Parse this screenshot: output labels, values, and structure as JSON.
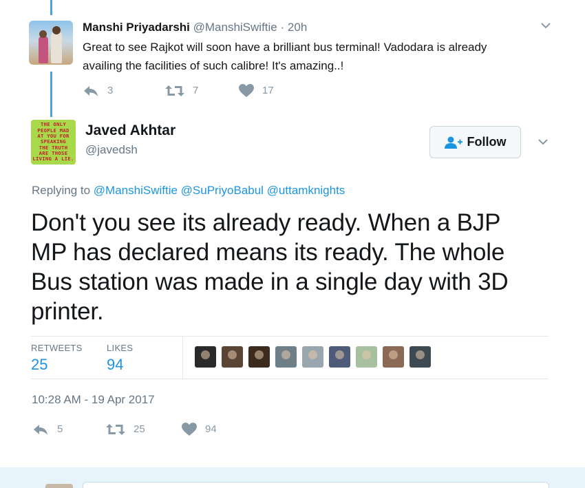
{
  "parent_tweet": {
    "name": "Manshi Priyadarshi",
    "handle": "@ManshiSwiftie",
    "dot": "·",
    "time": "20h",
    "text_line1": "Great to see Rajkot will soon have a brilliant bus terminal! Vadodara is already",
    "text_line2": "availing the facilities of such calibre! It's amazing..!",
    "replies": "3",
    "retweets": "7",
    "likes": "17"
  },
  "main_tweet": {
    "name": "Javed Akhtar",
    "handle": "@javedsh",
    "avatar_text": [
      "THE ONLY",
      "PEOPLE MAD",
      "AT YOU FOR",
      "SPEAKING",
      "THE TRUTH",
      "ARE THOSE",
      "LIVING A LIE."
    ],
    "follow_label": "Follow",
    "replying_prefix": "Replying to",
    "mentions": [
      "@ManshiSwiftie",
      "@SuPriyoBabul",
      "@uttamknights"
    ],
    "text_lines": [
      "Don't you see its already ready. When a BJP",
      "MP has declared means its ready. The whole",
      "Bus station was made in a single day with 3D",
      "printer."
    ],
    "retweets_label": "RETWEETS",
    "retweets_count": "25",
    "likes_label": "LIKES",
    "likes_count": "94",
    "timestamp": "10:28 AM - 19 Apr 2017",
    "action_replies": "5",
    "action_retweets": "25",
    "action_likes": "94"
  },
  "liker_avatars": [
    {
      "name": "liker-avatar-1",
      "color": "#2a2a2a"
    },
    {
      "name": "liker-avatar-2",
      "color": "#5a4436"
    },
    {
      "name": "liker-avatar-3",
      "color": "#3b2a1e"
    },
    {
      "name": "liker-avatar-4",
      "color": "#6f7f88"
    },
    {
      "name": "liker-avatar-5",
      "color": "#9aa6ae"
    },
    {
      "name": "liker-avatar-6",
      "color": "#4d5a78"
    },
    {
      "name": "liker-avatar-7",
      "color": "#a8c0a0"
    },
    {
      "name": "liker-avatar-8",
      "color": "#8a6a55"
    },
    {
      "name": "liker-avatar-9",
      "color": "#3e4a52"
    }
  ],
  "colors": {
    "accent": "#1b95e0",
    "muted": "#657786",
    "icon": "#8899a6",
    "thread_line": "#4aa3e0",
    "avatar_bg": "#a8d94a",
    "avatar_text": "#c0202a"
  }
}
